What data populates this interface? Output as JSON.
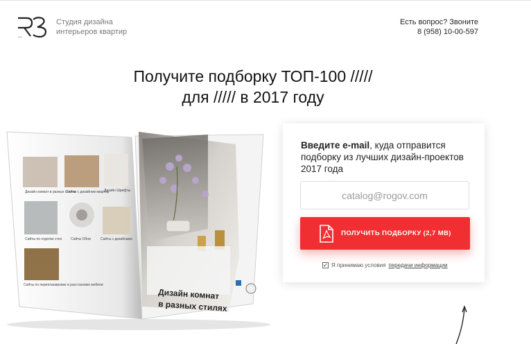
{
  "header": {
    "logo_text": "RS",
    "studio_line1": "Студия дизайна",
    "studio_line2": "интерьеров квартир",
    "contact_question": "Есть вопрос? Звоните",
    "contact_phone": "8 (958) 10-00-597"
  },
  "headline": {
    "line1": "Получите подборку ТОП-100 /////",
    "line2": "для ///// в 2017 году"
  },
  "form": {
    "lead_bold": "Введите e-mail",
    "lead_rest": ", куда отправится подборку из лучших дизайн-проектов 2017 года",
    "email_placeholder": "catalog@rogov.com",
    "button_label": "ПОЛУЧИТЬ ПОДБОРКУ (2,7 МВ)",
    "agree_text": "Я принимаю условия",
    "agree_link": "передачи информации",
    "agree_checked": "✓"
  },
  "book": {
    "cover_title_line1": "Дизайн комнат",
    "cover_title_line2": "в разных стилях",
    "left_captions": [
      "Дизайн комнат в разных стилях",
      "Сайты с дизайном квартир",
      "Дизайн Шрифты",
      "Сайты по отделке стен",
      "Сайты Обои",
      "Сайты с дизайнами",
      "Сайты по перепланировке и расстановке мебели"
    ]
  },
  "colors": {
    "accent": "#f12e32",
    "text": "#1a1a1a",
    "muted": "#7a7a7a"
  },
  "icons": [
    "logo-icon",
    "pdf-icon",
    "checkbox-icon",
    "arrow-icon"
  ]
}
